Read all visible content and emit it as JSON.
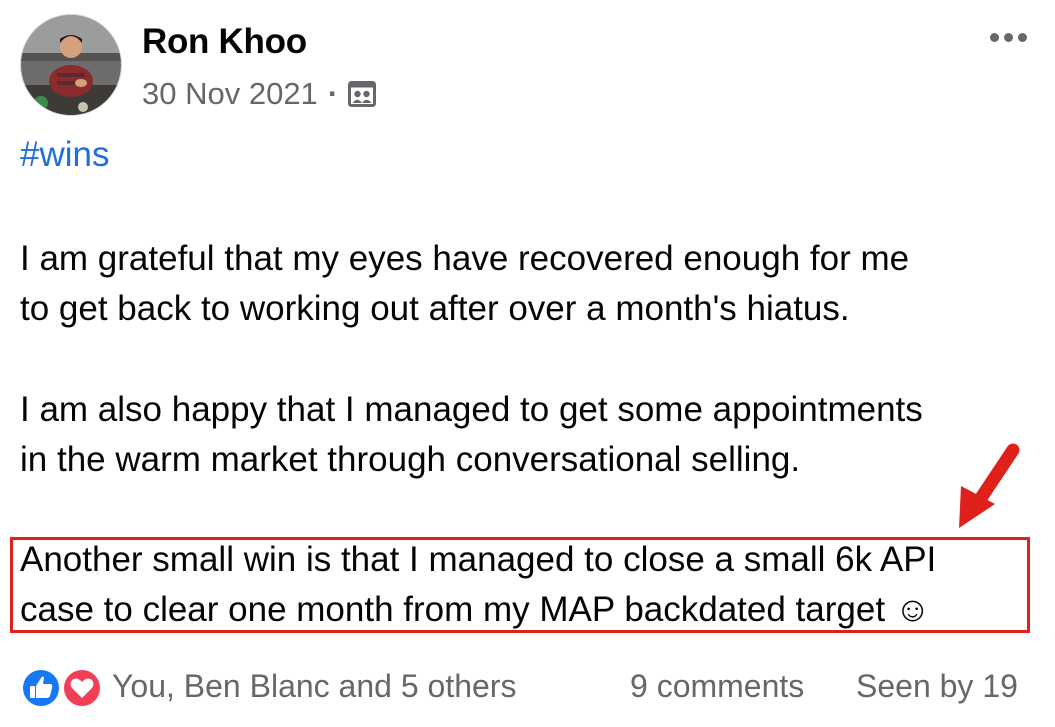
{
  "post": {
    "author": "Ron Khoo",
    "date": "30 Nov 2021",
    "separator": "·",
    "audience_icon": "group-audience-icon",
    "hashtag": "#wins",
    "paragraphs": [
      {
        "line1": "I am grateful that my eyes have recovered enough for me",
        "line2": "to get back to working out after over a month's hiatus."
      },
      {
        "line1": "I am also happy that I managed to get some appointments",
        "line2": "in the warm market through conversational selling."
      },
      {
        "line1": "Another small win is that I managed to close a small 6k API",
        "line2": "case to clear one month from my MAP backdated target ☺"
      }
    ]
  },
  "footer": {
    "reaction_icons": [
      "like-icon",
      "love-icon"
    ],
    "reactions_text": "You, Ben Blanc and 5 others",
    "comments_text": "9 comments",
    "seen_text": "Seen by 19"
  },
  "colors": {
    "link": "#216fdb",
    "meta": "#65676b",
    "highlight": "#e0211b",
    "like": "#1877f2",
    "love": "#f33e58"
  }
}
